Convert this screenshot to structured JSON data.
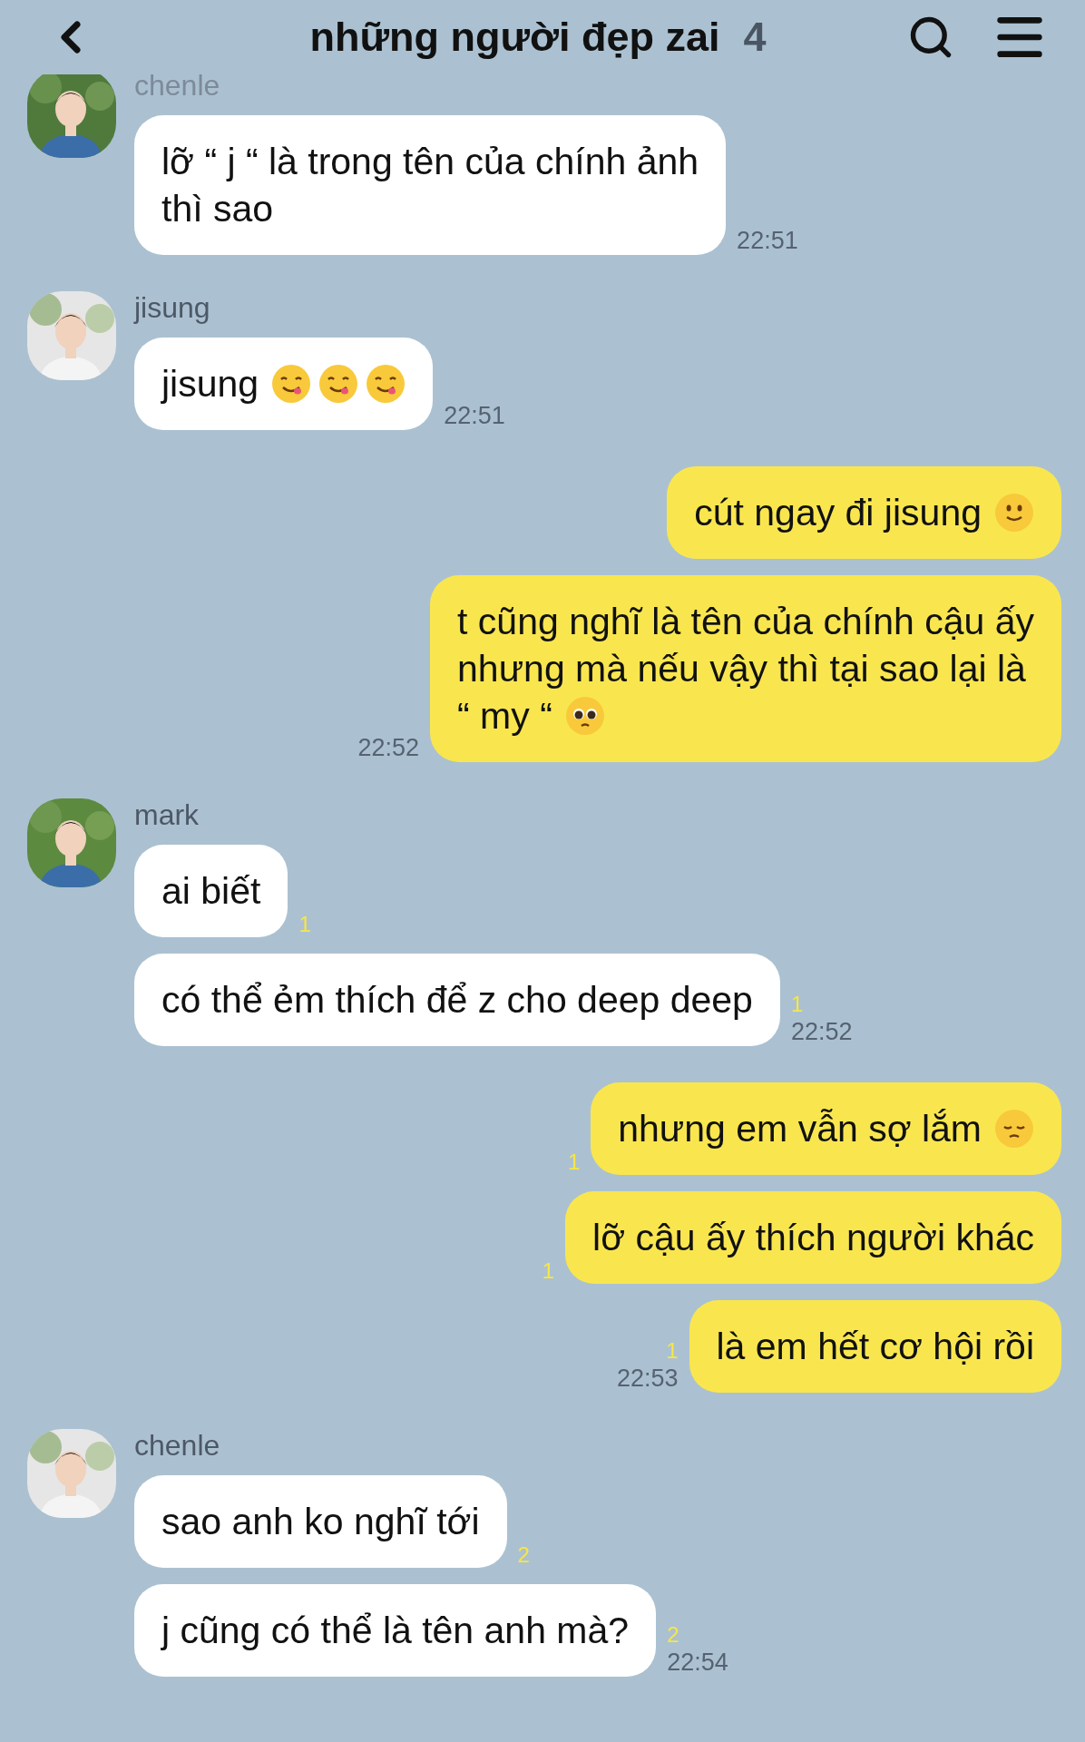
{
  "header": {
    "title": "những người đẹp zai",
    "member_count": "4"
  },
  "groups": [
    {
      "kind": "received",
      "sender": "chenle",
      "faded": true,
      "messages": [
        {
          "text": "lỡ “ j “ là trong tên của chính ảnh\nthì sao",
          "time": "22:51"
        }
      ]
    },
    {
      "kind": "received",
      "sender": "jisung",
      "faded": false,
      "messages": [
        {
          "text": "jisung",
          "emojis": [
            {
              "kind": "yum"
            },
            {
              "kind": "yum"
            },
            {
              "kind": "yum"
            }
          ],
          "time": "22:51"
        }
      ]
    },
    {
      "kind": "sent",
      "messages": [
        {
          "text": "cút ngay đi jisung",
          "emojis": [
            {
              "kind": "smile"
            }
          ]
        },
        {
          "text": "t cũng nghĩ là tên của chính cậu ấy\nnhưng mà nếu vậy thì tại sao lại là\n“ my “",
          "emojis": [
            {
              "kind": "pleading"
            }
          ],
          "time": "22:52"
        }
      ]
    },
    {
      "kind": "received",
      "sender": "mark",
      "faded": false,
      "messages": [
        {
          "text": "ai biết",
          "unread": "1"
        },
        {
          "text": "có thể ẻm thích để z cho deep deep",
          "unread": "1",
          "time": "22:52"
        }
      ]
    },
    {
      "kind": "sent",
      "messages": [
        {
          "text": "nhưng em vẫn sợ lắm",
          "emojis": [
            {
              "kind": "pensive"
            }
          ],
          "unread": "1"
        },
        {
          "text": "lỡ cậu ấy thích người khác",
          "unread": "1"
        },
        {
          "text": "là em hết cơ hội rồi",
          "unread": "1",
          "time": "22:53"
        }
      ]
    },
    {
      "kind": "received",
      "sender": "chenle",
      "faded": false,
      "messages": [
        {
          "text": "sao anh ko nghĩ tới",
          "unread": "2"
        },
        {
          "text": "j cũng có thể là tên anh mà?",
          "unread": "2",
          "time": "22:54"
        }
      ]
    }
  ]
}
